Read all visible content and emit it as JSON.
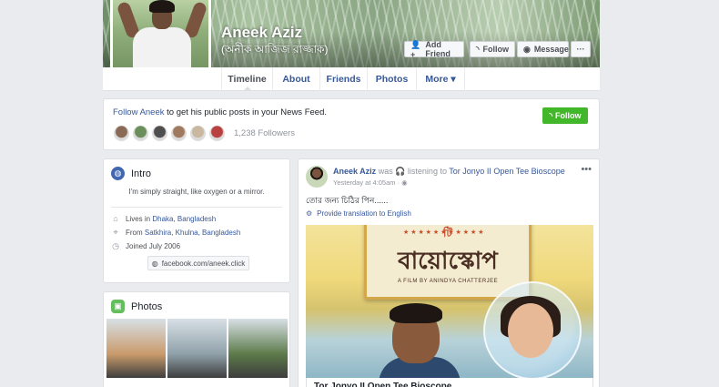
{
  "profile": {
    "name": "Aneek Aziz",
    "alt_name": "(অনীক আজিজ রাজ্জাক)"
  },
  "cover_buttons": {
    "add_friend": "Add Friend",
    "follow": "Follow",
    "message": "Message",
    "more": "···"
  },
  "tabs": [
    {
      "label": "Timeline",
      "active": true
    },
    {
      "label": "About"
    },
    {
      "label": "Friends"
    },
    {
      "label": "Photos"
    },
    {
      "label": "More ▾"
    }
  ],
  "follow_banner": {
    "link": "Follow Aneek",
    "text": " to get his public posts in your News Feed.",
    "followers": "1,238 Followers",
    "button": "Follow",
    "face_colors": [
      "#8a6a55",
      "#6b8f5a",
      "#4e4e4e",
      "#a07a5e",
      "#c9b7a0",
      "#b94040"
    ]
  },
  "intro": {
    "title": "Intro",
    "bio": "I'm simply straight, like oxygen or a mirror.",
    "lives_prefix": "Lives in ",
    "lives_link": "Dhaka, Bangladesh",
    "from_prefix": "From ",
    "from_link": "Satkhira, Khulna, Bangladesh",
    "joined": "Joined July 2006",
    "website": "facebook.com/aneek.click"
  },
  "photos_card": {
    "title": "Photos",
    "tiles": [
      "#c99a6b",
      "#8fa0a8",
      "#5c7a4a"
    ]
  },
  "post": {
    "author": "Aneek Aziz",
    "was": " was ",
    "activity": " listening to ",
    "target": "Tor Jonyo II Open Tee Bioscope",
    "meta": "Yesterday at 4:05am · ◉",
    "text": "তোর জন্য চিঠির পিন......",
    "translate": "Provide translation to English",
    "poster_top": "টি",
    "poster_title": "বায়োস্কোপ",
    "poster_sub": "A FILM BY ANINDYA CHATTERJEE",
    "caption": "Tor Jonyo II Open Tee Bioscope"
  },
  "colors": {
    "brand_blue": "#4267b2",
    "link_blue": "#365899",
    "follow_green": "#42b72a",
    "page_bg": "#e9ebee"
  }
}
